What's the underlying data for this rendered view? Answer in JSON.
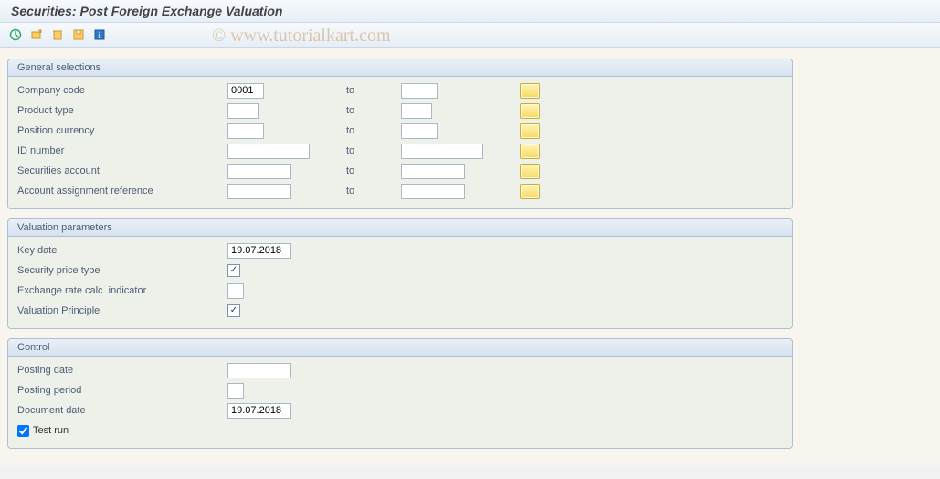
{
  "title": "Securities: Post Foreign Exchange Valuation",
  "watermark": "© www.tutorialkart.com",
  "toolbar": {
    "execute": "execute",
    "variants": "get-variant",
    "delete": "delete",
    "save": "save-variant",
    "info": "information"
  },
  "groups": {
    "general": {
      "title": "General selections",
      "rows": [
        {
          "label": "Company code",
          "from": "0001",
          "to": "",
          "fw": "w40",
          "tw": "w40"
        },
        {
          "label": "Product type",
          "from": "",
          "to": "",
          "fw": "w34",
          "tw": "w34"
        },
        {
          "label": "Position currency",
          "from": "",
          "to": "",
          "fw": "w40",
          "tw": "w40"
        },
        {
          "label": "ID number",
          "from": "",
          "to": "",
          "fw": "w90",
          "tw": "w90"
        },
        {
          "label": "Securities account",
          "from": "",
          "to": "",
          "fw": "w70",
          "tw": "w70"
        },
        {
          "label": "Account assignment reference",
          "from": "",
          "to": "",
          "fw": "w70",
          "tw": "w70"
        }
      ],
      "to_label": "to"
    },
    "valuation": {
      "title": "Valuation parameters",
      "key_date_label": "Key date",
      "key_date": "19.07.2018",
      "sec_price_label": "Security price type",
      "sec_price_checked": true,
      "exch_label": "Exchange rate calc. indicator",
      "exch_value": "",
      "val_principle_label": "Valuation Principle",
      "val_principle_checked": true
    },
    "control": {
      "title": "Control",
      "posting_date_label": "Posting date",
      "posting_date": "",
      "posting_period_label": "Posting period",
      "posting_period": "",
      "document_date_label": "Document date",
      "document_date": "19.07.2018",
      "test_run_label": "Test run",
      "test_run_checked": true
    }
  }
}
